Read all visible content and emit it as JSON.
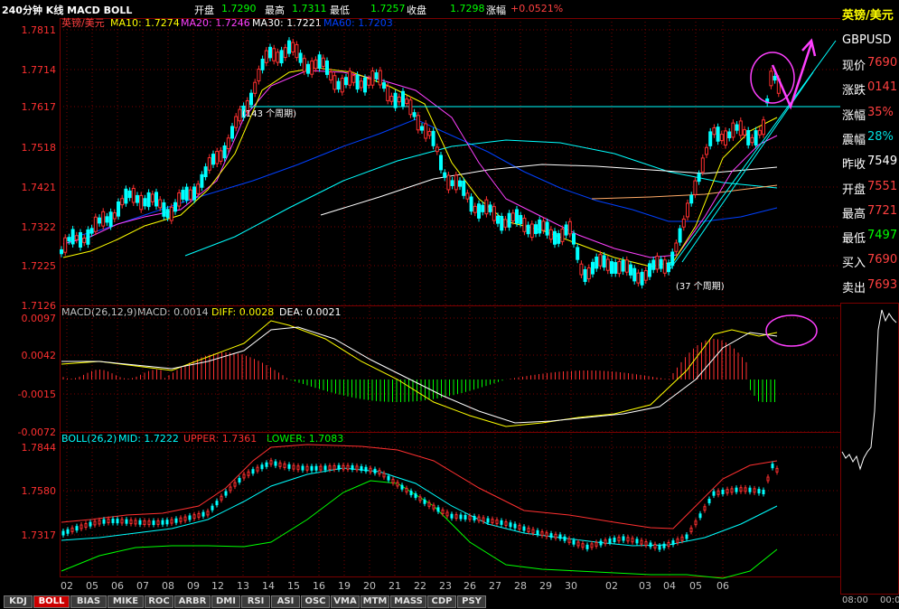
{
  "header": {
    "title": "240分钟 K线 MACD BOLL",
    "open_label": "开盘",
    "open_value": "1.7290",
    "high_label": "最高",
    "high_value": "1.7311",
    "low_label": "最低",
    "low_value": "1.7257",
    "close_label": "收盘",
    "close_value": "1.7298",
    "change_label": "涨幅",
    "change_value": "+0.0521%"
  },
  "kline": {
    "symbol_label": "英镑/美元",
    "ma10": "MA10: 1.7274",
    "ma20": "MA20: 1.7246",
    "ma30": "MA30: 1.7221",
    "ma60": "MA60: 1.7203",
    "y_ticks": [
      "1.7811",
      "1.7714",
      "1.7617",
      "1.7518",
      "1.7421",
      "1.7322",
      "1.7225",
      "1.7126"
    ],
    "annotation_143": "(143 个周期)",
    "annotation_37": "(37 个周期)"
  },
  "macd": {
    "label": "MACD(26,12,9)",
    "macd": "MACD: 0.0014",
    "diff": "DIFF: 0.0028",
    "dea": "DEA: 0.0021",
    "y_ticks": [
      "0.0097",
      "0.0042",
      "-0.0015",
      "-0.0072"
    ]
  },
  "boll": {
    "label": "BOLL(26,2)",
    "mid": "MID: 1.7222",
    "upper": "UPPER: 1.7361",
    "lower": "LOWER: 1.7083",
    "y_ticks": [
      "1.7844",
      "1.7580",
      "1.7317"
    ]
  },
  "x_labels": [
    "02",
    "05",
    "06",
    "07",
    "08",
    "09",
    "12",
    "13",
    "14",
    "15",
    "16",
    "19",
    "20",
    "21",
    "22",
    "23",
    "26",
    "27",
    "28",
    "29",
    "30",
    "02",
    "03",
    "04",
    "05",
    "06"
  ],
  "tabs": [
    "KDJ",
    "BOLL",
    "BIAS",
    "MIKE",
    "ROC",
    "ARBR",
    "DMI",
    "RSI",
    "ASI",
    "OSC",
    "VMA",
    "MTM",
    "MASS",
    "CDP",
    "PSY"
  ],
  "active_tab": "BOLL",
  "sidebar": {
    "title": "英镑/美元",
    "code": "GBPUSD",
    "rows": [
      {
        "label": "现价",
        "value": "7690",
        "color": "#ff4040"
      },
      {
        "label": "涨跌",
        "value": "0141",
        "color": "#ff4040"
      },
      {
        "label": "涨幅",
        "value": "35%",
        "color": "#ff4040"
      },
      {
        "label": "震幅",
        "value": "28%",
        "color": "#00e0e0"
      },
      {
        "label": "昨收",
        "value": "7549",
        "color": "#ffffff"
      },
      {
        "label": "开盘",
        "value": "7551",
        "color": "#ff4040"
      },
      {
        "label": "最高",
        "value": "7721",
        "color": "#ff4040"
      },
      {
        "label": "最低",
        "value": "7497",
        "color": "#00ff00"
      },
      {
        "label": "买入",
        "value": "7690",
        "color": "#ff4040"
      },
      {
        "label": "卖出",
        "value": "7693",
        "color": "#ff4040"
      }
    ],
    "time_left": "08:00",
    "time_right": "00:0"
  },
  "colors": {
    "grid": "#7a0000",
    "up": "#ff3030",
    "down": "#00ffff",
    "ma10": "#ffff00",
    "ma20": "#ff40ff",
    "ma30": "#00ff00",
    "ma60": "#0040ff"
  }
}
